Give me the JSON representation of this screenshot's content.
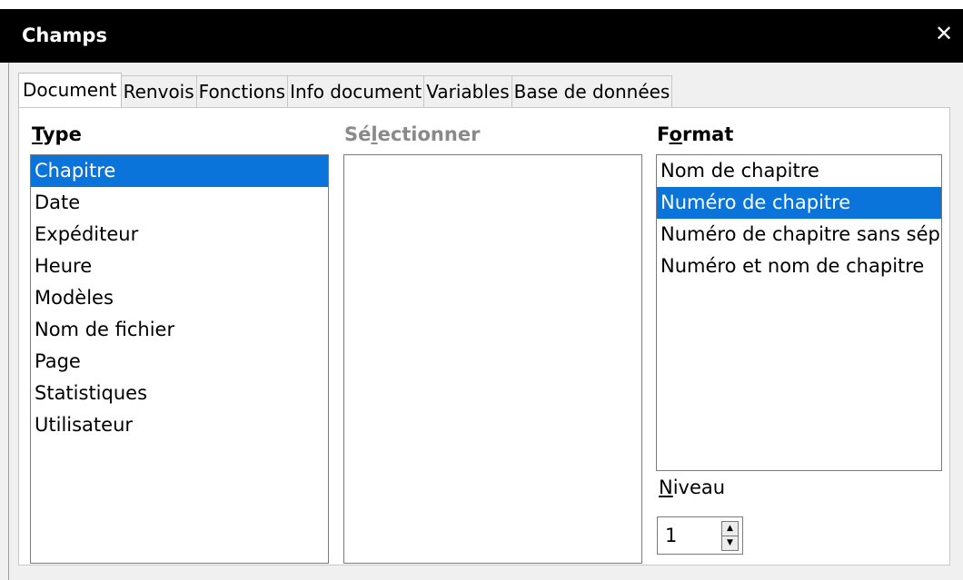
{
  "window": {
    "title": "Champs",
    "close_glyph": "✕"
  },
  "tabs": [
    {
      "label": "Document",
      "active": true
    },
    {
      "label": "Renvois"
    },
    {
      "label": "Fonctions"
    },
    {
      "label": "Info document"
    },
    {
      "label": "Variables"
    },
    {
      "label": "Base de données"
    }
  ],
  "type_column": {
    "label_underlined": "T",
    "label_rest": "ype",
    "items": [
      "Chapitre",
      "Date",
      "Expéditeur",
      "Heure",
      "Modèles",
      "Nom de fichier",
      "Page",
      "Statistiques",
      "Utilisateur"
    ],
    "selected": "Chapitre"
  },
  "select_column": {
    "label_before": "Sé",
    "label_underlined": "l",
    "label_after": "ectionner"
  },
  "format_column": {
    "label_before": "F",
    "label_underlined": "o",
    "label_after": "rmat",
    "items": [
      "Nom de chapitre",
      "Numéro de chapitre",
      "Numéro de chapitre sans sépa",
      "Numéro et nom de chapitre"
    ],
    "selected": "Numéro de chapitre"
  },
  "level": {
    "label_underlined": "N",
    "label_rest": "iveau",
    "value": "1",
    "up_glyph": "▲",
    "down_glyph": "▼"
  },
  "colors": {
    "selection": "#0a74da",
    "titlebar": "#000000"
  }
}
